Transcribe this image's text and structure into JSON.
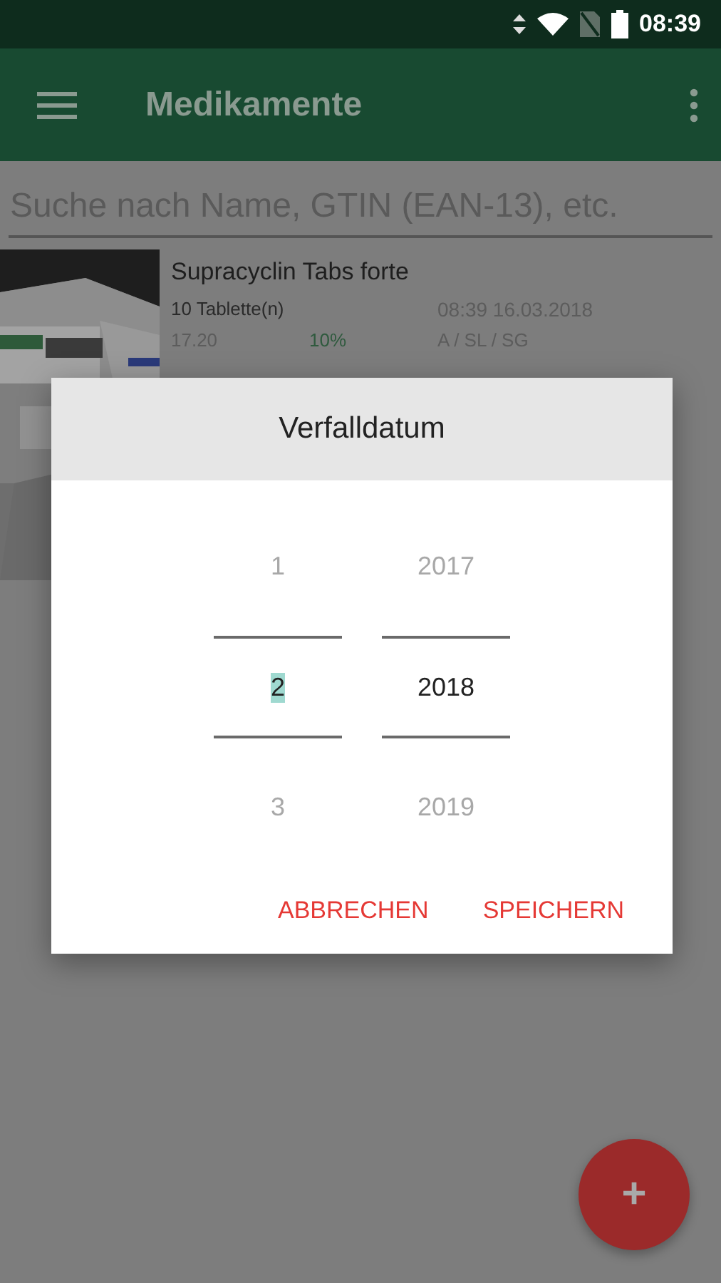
{
  "status_bar": {
    "time": "08:39"
  },
  "app_bar": {
    "title": "Medikamente"
  },
  "search": {
    "placeholder": "Suche nach Name, GTIN (EAN-13), etc."
  },
  "medications": [
    {
      "name": "Supracyclin Tabs forte",
      "quantity": "10 Tablette(n)",
      "timestamp": "08:39 16.03.2018",
      "price": "17.20",
      "percent": "10%",
      "category": "A / SL / SG"
    }
  ],
  "dialog": {
    "title": "Verfalldatum",
    "pickers": [
      {
        "highlighted": true,
        "values": [
          {
            "text": "1",
            "selected": false
          },
          {
            "text": "2",
            "selected": true
          },
          {
            "text": "3",
            "selected": false
          }
        ]
      },
      {
        "highlighted": false,
        "values": [
          {
            "text": "2017",
            "selected": false
          },
          {
            "text": "2018",
            "selected": true
          },
          {
            "text": "2019",
            "selected": false
          }
        ]
      }
    ],
    "buttons": [
      "ABBRECHEN",
      "SPEICHERN"
    ]
  },
  "fab": {
    "label": "+"
  }
}
